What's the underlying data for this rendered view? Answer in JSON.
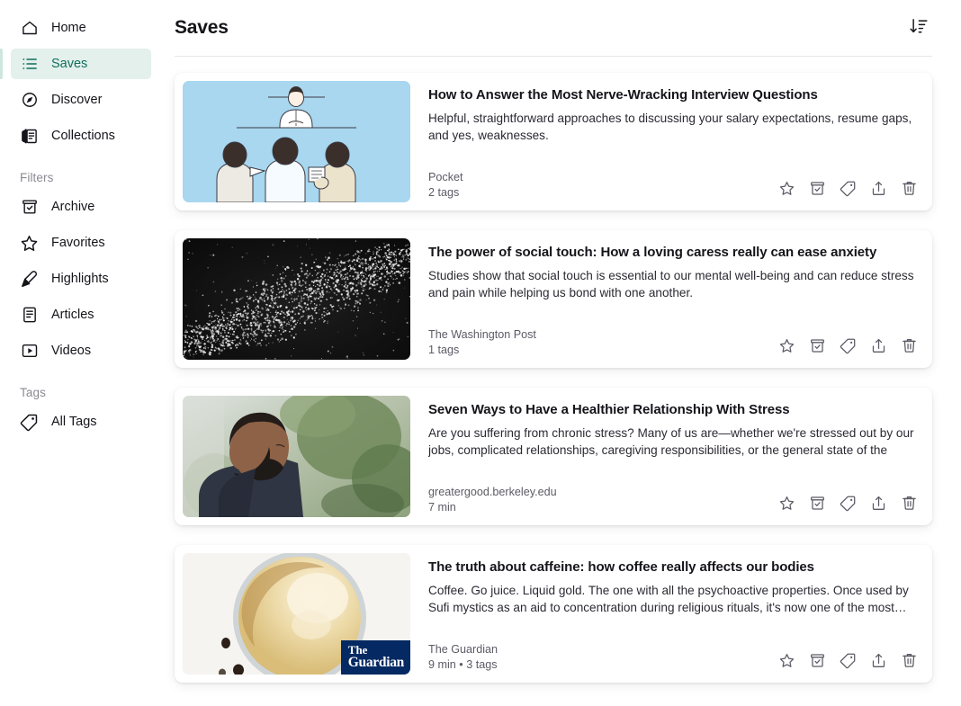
{
  "sidebar": {
    "primary": [
      {
        "label": "Home",
        "icon": "home-icon",
        "active": false
      },
      {
        "label": "Saves",
        "icon": "list-icon",
        "active": true
      },
      {
        "label": "Discover",
        "icon": "compass-icon",
        "active": false
      },
      {
        "label": "Collections",
        "icon": "collections-icon",
        "active": false
      }
    ],
    "filters_label": "Filters",
    "filters": [
      {
        "label": "Archive",
        "icon": "archive-icon"
      },
      {
        "label": "Favorites",
        "icon": "star-icon"
      },
      {
        "label": "Highlights",
        "icon": "highlighter-icon"
      },
      {
        "label": "Articles",
        "icon": "article-icon"
      },
      {
        "label": "Videos",
        "icon": "video-icon"
      }
    ],
    "tags_label": "Tags",
    "tags": [
      {
        "label": "All Tags",
        "icon": "tag-icon"
      }
    ]
  },
  "header": {
    "title": "Saves",
    "sort_icon": "sort-descending-icon"
  },
  "colors": {
    "accent_text": "#0f6f5c",
    "accent_bg": "#e3f0ec",
    "text_primary": "#15141a",
    "text_secondary": "#5b5b66",
    "guardian_blue": "#052962"
  },
  "action_icons": [
    "favorite-star-icon",
    "archive-icon",
    "tag-icon",
    "share-icon",
    "delete-icon"
  ],
  "items": [
    {
      "title": "How to Answer the Most Nerve-Wracking Interview Questions",
      "excerpt": "Helpful, straightforward approaches to discussing your salary expectations, resume gaps, and yes, weaknesses.",
      "source": "Pocket",
      "detail": "2 tags",
      "thumb": "interview-panel-illustration",
      "thumb_bg": "#a8d7ef"
    },
    {
      "title": "The power of social touch: How a loving caress really can ease anxiety",
      "excerpt": "Studies show that social touch is essential to our mental well-being and can reduce stress and pain while helping us bond with one another.",
      "source": "The Washington Post",
      "detail": "1 tags",
      "thumb": "particle-field-photo",
      "thumb_bg": "#141414"
    },
    {
      "title": "Seven Ways to Have a Healthier Relationship With Stress",
      "excerpt": "Are you suffering from chronic stress? Many of us are—whether we're stressed out by our jobs, complicated relationships, caregiving responsibilities, or the general state of the worl…",
      "source": "greatergood.berkeley.edu",
      "detail": "7 min",
      "thumb": "bearded-man-outdoors-photo",
      "thumb_bg": "#7d8a6e"
    },
    {
      "title": "The truth about caffeine: how coffee really affects our bodies",
      "excerpt": "Coffee. Go juice. Liquid gold. The one with all the psychoactive properties. Once used by Sufi mystics as an aid to concentration during religious rituals, it's now one of the most…",
      "source": "The Guardian",
      "detail": "9 min  •  3 tags",
      "thumb": "coffee-cup-photo",
      "thumb_bg": "#f5f3ef",
      "badge_line1": "The",
      "badge_line2": "Guardian"
    }
  ]
}
